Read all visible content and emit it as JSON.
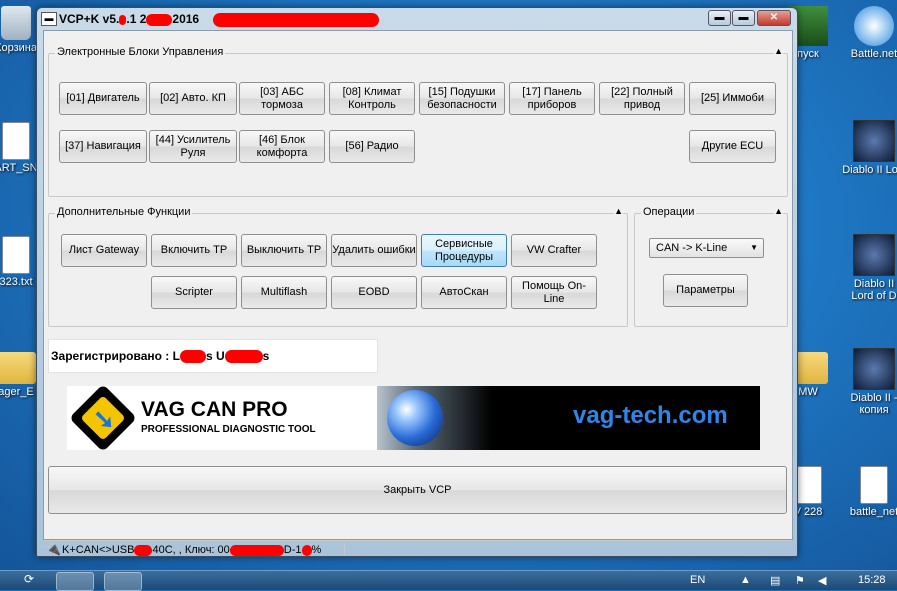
{
  "desktop": {
    "icons_left": [
      {
        "label": "Корзина",
        "kind": "bin"
      },
      {
        "label": "ART_SN",
        "kind": "doc"
      },
      {
        "label": "323.txt",
        "kind": "doc"
      },
      {
        "label": "ager_E",
        "kind": "folder"
      }
    ],
    "icons_right_col1": [
      {
        "label": "пуск",
        "kind": "green"
      },
      {
        "label": "MW",
        "kind": "folder"
      },
      {
        "label": "V 228",
        "kind": "doc"
      }
    ],
    "icons_right_col2": [
      {
        "label": "Battle.net",
        "kind": "bnet"
      },
      {
        "label": "Diablo II LoD",
        "kind": "diablo"
      },
      {
        "label": "Diablo II Lord of D",
        "kind": "diablo"
      },
      {
        "label": "Diablo II - копия",
        "kind": "diablo"
      },
      {
        "label": "battle_net",
        "kind": "doc"
      }
    ]
  },
  "taskbar": {
    "language": "EN",
    "time": "15:28"
  },
  "window": {
    "title_prefix": "VCP+K v5.",
    "title_mid": ".1 2",
    "title_year": "2016",
    "minimize_label": "▬",
    "maximize_label": "▬",
    "close_label": "✕"
  },
  "ecu_group": {
    "label": "Электронные Блоки Управления",
    "arrow": "▲",
    "buttons": [
      "[01] Двигатель",
      "[02] Авто. КП",
      "[03] АБС тормоза",
      "[08] Климат Контроль",
      "[15] Подушки безопасности",
      "[17] Панель приборов",
      "[22] Полный привод",
      "[25] Иммоби",
      "[37] Навигация",
      "[44] Усилитель Руля",
      "[46] Блок комфорта",
      "[56] Радио",
      "Другие ECU"
    ]
  },
  "extra_group": {
    "label": "Дополнительные Функции",
    "arrow": "▲",
    "buttons": [
      "Лист Gateway",
      "Включить TP",
      "Выключить TP",
      "Удалить ошибки",
      "Сервисные Процедуры",
      "VW Crafter",
      "Scripter",
      "Multiflash",
      "EOBD",
      "АвтоСкан",
      "Помощь On-Line"
    ]
  },
  "ops_group": {
    "label": "Операции",
    "arrow": "▲",
    "select_value": "CAN -> K-Line",
    "params_button": "Параметры"
  },
  "registration": {
    "prefix": "Зарегистрировано : L",
    "part2": "s U",
    "part3": "s"
  },
  "banner": {
    "title": "VAG CAN PRO",
    "subtitle": "PROFESSIONAL DIAGNOSTIC TOOL",
    "url": "vag-tech.com"
  },
  "close_button": "Закрыть VCP",
  "status": {
    "part1": "K+CAN<>USB",
    "part2": "40C, , Ключ: 00",
    "part3": "D-1",
    "part4": "%"
  }
}
